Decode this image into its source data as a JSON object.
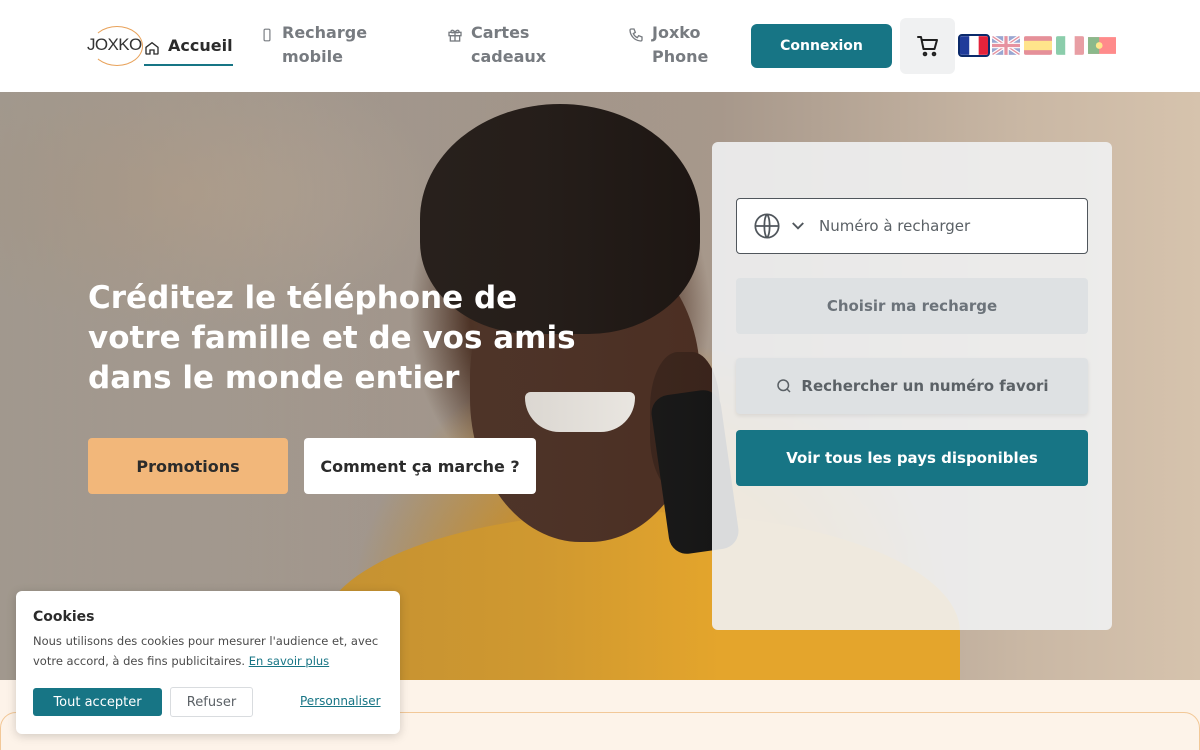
{
  "header": {
    "logo_text": "JOXKO",
    "nav": [
      {
        "label": "Accueil",
        "icon": "home-icon",
        "active": true
      },
      {
        "label": "Recharge mobile",
        "icon": "mobile-icon"
      },
      {
        "label": "Cartes cadeaux",
        "icon": "gift-icon"
      },
      {
        "label": "Joxko Phone",
        "icon": "phone-icon"
      }
    ],
    "login_label": "Connexion",
    "cart_icon": "cart-icon",
    "languages": [
      "fr",
      "en",
      "es",
      "it",
      "pt"
    ],
    "selected_language": "fr"
  },
  "hero": {
    "title": "Créditez le téléphone de votre famille et de vos amis dans le monde entier",
    "promo_label": "Promotions",
    "how_label": "Comment ça marche ?"
  },
  "recharge": {
    "phone_placeholder": "Numéro à recharger",
    "choose_label": "Choisir ma recharge",
    "favorite_label": "Rechercher un numéro favori",
    "countries_label": "Voir tous les pays disponibles"
  },
  "cookies": {
    "title": "Cookies",
    "text": "Nous utilisons des cookies pour mesurer l'audience et, avec votre accord, à des fins publicitaires.",
    "learn_more": "En savoir plus",
    "accept_label": "Tout accepter",
    "refuse_label": "Refuser",
    "customize_label": "Personnaliser"
  },
  "colors": {
    "primary": "#177585",
    "promo": "#f2b77a",
    "logo_accent": "#e8a25a"
  }
}
